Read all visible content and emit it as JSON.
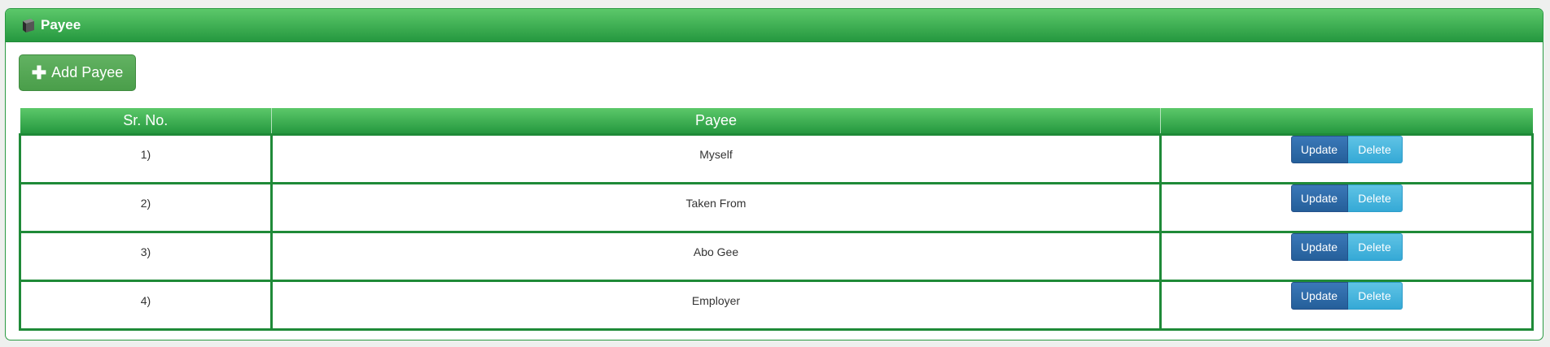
{
  "panel": {
    "title": "Payee"
  },
  "toolbar": {
    "add_label": "Add Payee"
  },
  "table": {
    "headers": [
      "Sr. No.",
      "Payee",
      ""
    ],
    "rows": [
      {
        "sr": "1)",
        "payee": "Myself",
        "update": "Update",
        "delete": "Delete"
      },
      {
        "sr": "2)",
        "payee": "Taken From",
        "update": "Update",
        "delete": "Delete"
      },
      {
        "sr": "3)",
        "payee": "Abo Gee",
        "update": "Update",
        "delete": "Delete"
      },
      {
        "sr": "4)",
        "payee": "Employer",
        "update": "Update",
        "delete": "Delete"
      }
    ]
  },
  "colors": {
    "header_green": "#25983f",
    "border_green": "#1f8a38",
    "add_button": "#4a9e4a",
    "update_button": "#255f9a",
    "delete_button": "#35a9d6"
  },
  "icons": {
    "heading": "cube-icon",
    "add": "plus-icon"
  }
}
